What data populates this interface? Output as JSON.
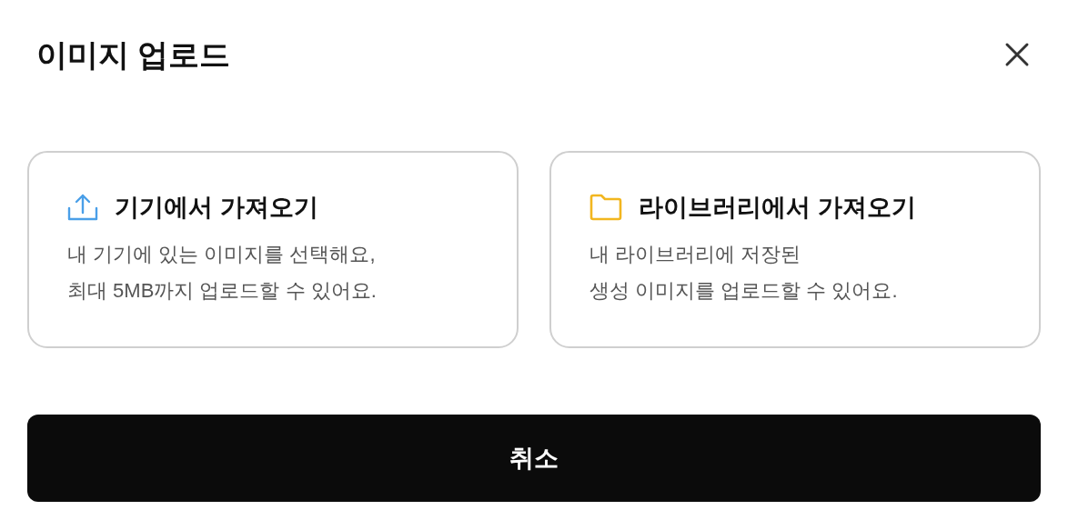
{
  "dialog": {
    "title": "이미지 업로드"
  },
  "options": [
    {
      "kind": "upload",
      "title": "기기에서 가져오기",
      "description": [
        "내 기기에 있는 이미지를 선택해요,",
        "최대 5MB까지 업로드할 수 있어요."
      ]
    },
    {
      "kind": "folder",
      "title": "라이브러리에서 가져오기",
      "description": [
        "내 라이브러리에 저장된",
        "생성 이미지를 업로드할 수 있어요."
      ]
    }
  ],
  "cancel_button": "취소"
}
